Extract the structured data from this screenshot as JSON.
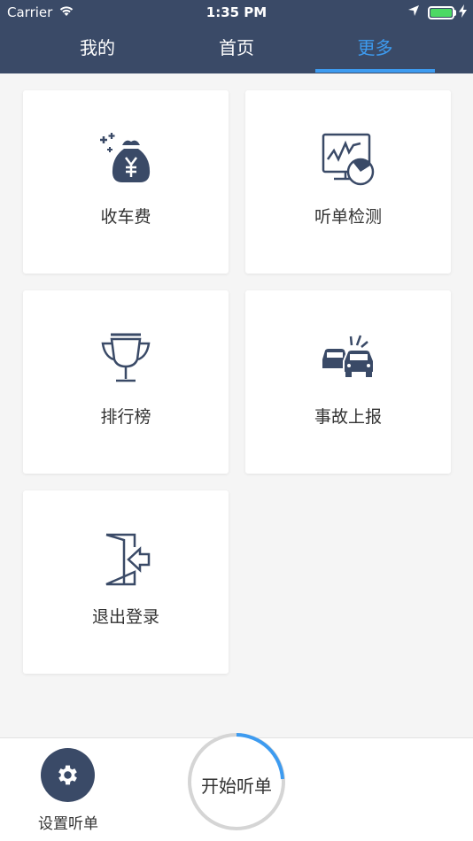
{
  "status_bar": {
    "carrier": "Carrier",
    "time": "1:35 PM"
  },
  "tabs": [
    {
      "label": "我的"
    },
    {
      "label": "首页"
    },
    {
      "label": "更多",
      "active": true
    }
  ],
  "cards": [
    {
      "label": "收车费",
      "icon": "money-bag-icon"
    },
    {
      "label": "听单检测",
      "icon": "monitor-gauge-icon"
    },
    {
      "label": "排行榜",
      "icon": "trophy-icon"
    },
    {
      "label": "事故上报",
      "icon": "car-accident-icon"
    },
    {
      "label": "退出登录",
      "icon": "logout-door-icon"
    }
  ],
  "bottom": {
    "settings_label": "设置听单",
    "start_label": "开始听单"
  },
  "colors": {
    "header": "#3a4a67",
    "accent": "#3d9bf0",
    "icon": "#3a4a67",
    "battery": "#4cd964"
  }
}
